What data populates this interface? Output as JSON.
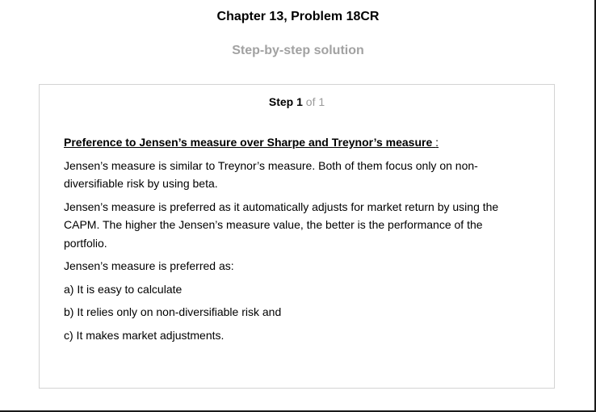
{
  "header": {
    "title": "Chapter 13, Problem 18CR",
    "subtitle": "Step-by-step solution"
  },
  "step": {
    "label": "Step",
    "number": "1",
    "of_text": "of 1"
  },
  "solution": {
    "heading": "Preference to Jensen’s measure over Sharpe and Treynor’s measure ",
    "heading_colon": ":",
    "paragraphs": [
      "Jensen’s measure is similar to Treynor’s measure. Both of them focus only on non-diversifiable risk by using beta.",
      "Jensen’s measure is preferred as it automatically adjusts for market return by using the CAPM. The higher the Jensen’s measure value, the better is the performance of the portfolio.",
      "Jensen’s measure is preferred as:",
      "a) It is easy to calculate",
      "b) It relies only on non-diversifiable risk and",
      "c) It makes market adjustments."
    ]
  }
}
